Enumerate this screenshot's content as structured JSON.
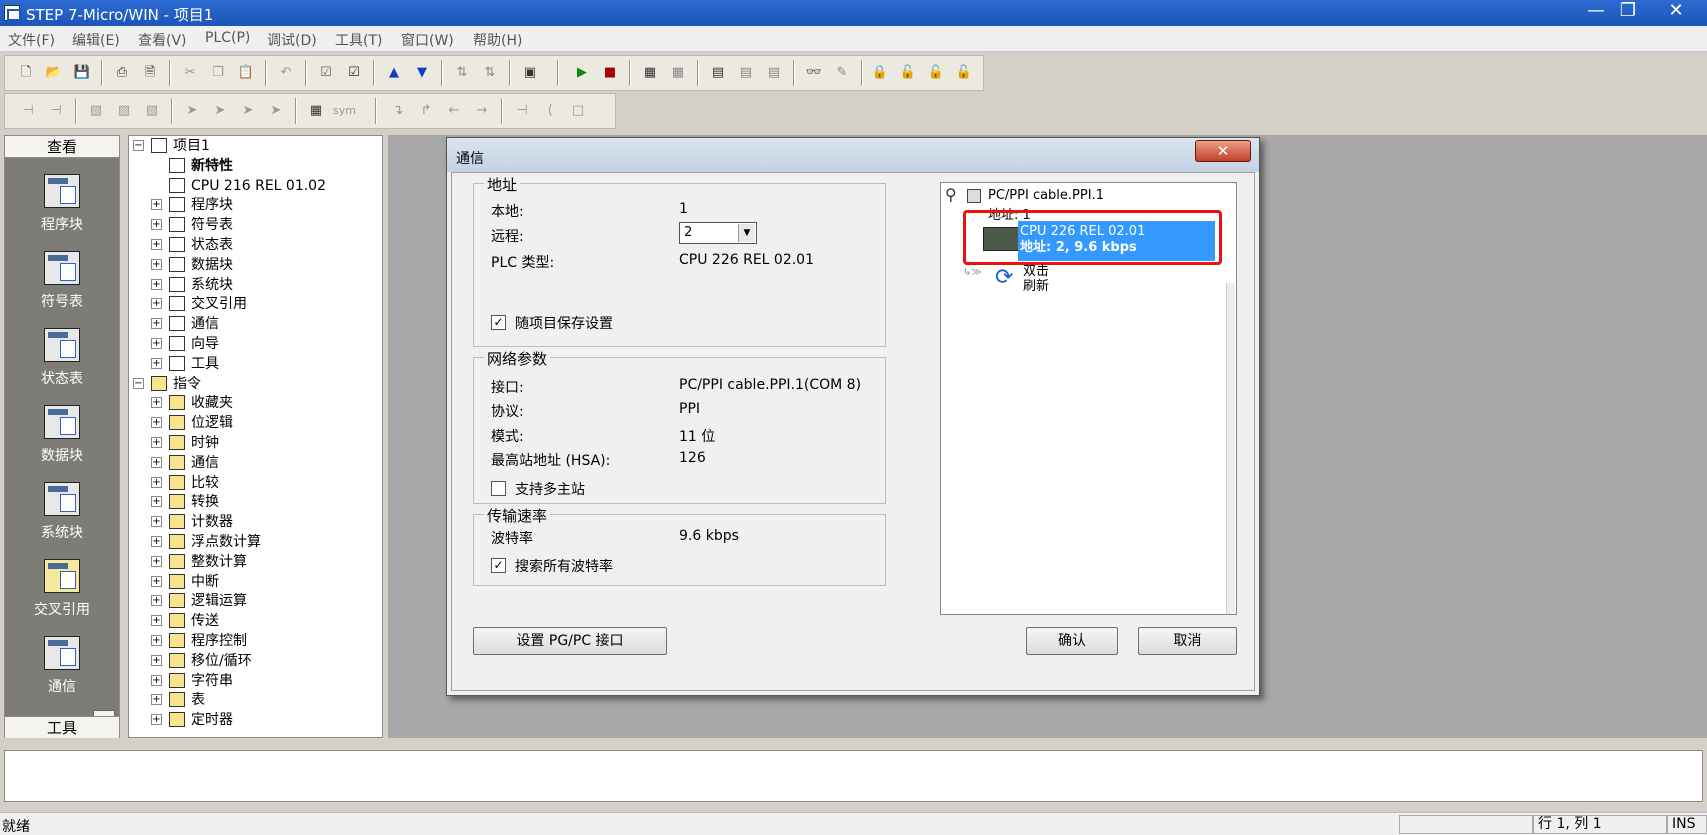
{
  "window": {
    "title": "STEP 7-Micro/WIN - 项目1"
  },
  "menu": [
    "文件(F)",
    "编辑(E)",
    "查看(V)",
    "PLC(P)",
    "调试(D)",
    "工具(T)",
    "窗口(W)",
    "帮助(H)"
  ],
  "view_panel": {
    "header": "查看",
    "items": [
      "程序块",
      "符号表",
      "状态表",
      "数据块",
      "系统块",
      "交叉引用",
      "通信"
    ],
    "footer": "工具"
  },
  "tree": {
    "root": "项目1",
    "new_features": "新特性",
    "cpu": "CPU 216 REL 01.02",
    "project_items": [
      "程序块",
      "符号表",
      "状态表",
      "数据块",
      "系统块",
      "交叉引用",
      "通信",
      "向导",
      "工具"
    ],
    "instructions": "指令",
    "instruction_items": [
      "收藏夹",
      "位逻辑",
      "时钟",
      "通信",
      "比较",
      "转换",
      "计数器",
      "浮点数计算",
      "整数计算",
      "中断",
      "逻辑运算",
      "传送",
      "程序控制",
      "移位/循环",
      "字符串",
      "表",
      "定时器"
    ]
  },
  "dialog": {
    "title": "通信",
    "close_glyph": "✕",
    "address": {
      "group": "地址",
      "local_label": "本地:",
      "local_value": "1",
      "remote_label": "远程:",
      "remote_value": "2",
      "plc_type_label": "PLC 类型:",
      "plc_type_value": "CPU 226 REL 02.01",
      "save_with_project": "随项目保存设置",
      "save_checked": true
    },
    "network": {
      "group": "网络参数",
      "interface_label": "接口:",
      "interface_value": "PC/PPI cable.PPI.1(COM 8)",
      "protocol_label": "协议:",
      "protocol_value": "PPI",
      "mode_label": "模式:",
      "mode_value": "11 位",
      "hsa_label": "最高站地址 (HSA):",
      "hsa_value": "126",
      "multi_master": "支持多主站",
      "multi_master_checked": false
    },
    "baud": {
      "group": "传输速率",
      "rate_label": "波特率",
      "rate_value": "9.6 kbps",
      "search_all": "搜索所有波特率",
      "search_checked": true
    },
    "set_pgpc_button": "设置 PG/PC 接口",
    "ok_button": "确认",
    "cancel_button": "取消",
    "net_tree": {
      "cable": "PC/PPI cable.PPI.1",
      "cable_address": "地址: 1",
      "cpu_line1": "CPU 226 REL 02.01",
      "cpu_line2": "地址: 2, 9.6 kbps",
      "refresh_line1": "双击",
      "refresh_line2": "刷新"
    }
  },
  "status": {
    "ready": "就绪",
    "position": "行 1, 列 1",
    "mode": "INS"
  }
}
